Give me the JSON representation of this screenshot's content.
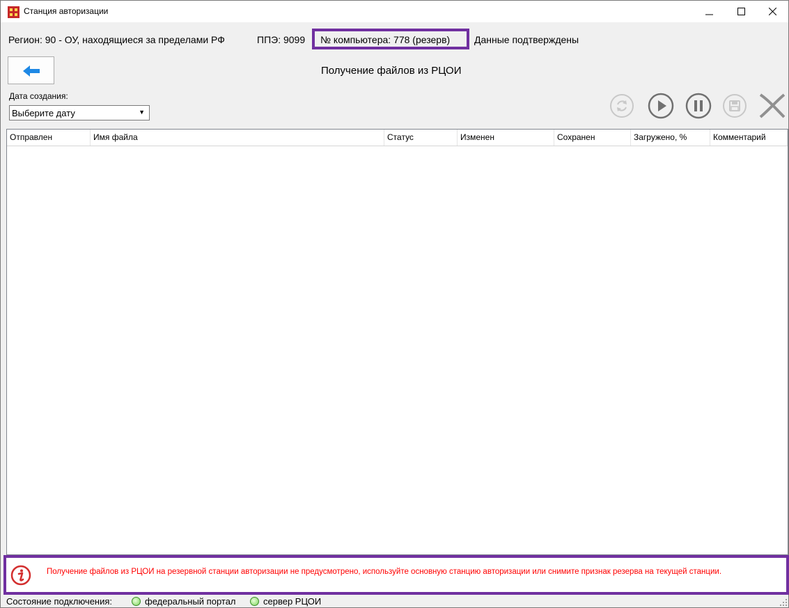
{
  "window": {
    "title": "Станция авторизации",
    "icon": "app-logo-icon"
  },
  "info": {
    "region": "Регион: 90 - ОУ, находящиеся за пределами РФ",
    "ppe": "ППЭ: 9099",
    "computer": "№ компьютера: 778 (резерв)",
    "status": "Данные подтверждены"
  },
  "page": {
    "title": "Получение файлов из РЦОИ"
  },
  "filter": {
    "label": "Дата создания:",
    "value": "Выберите дату"
  },
  "toolbar": [
    "refresh-icon",
    "play-icon",
    "pause-icon",
    "save-icon",
    "cancel-icon"
  ],
  "table": {
    "columns": [
      "Отправлен",
      "Имя файла",
      "Статус",
      "Изменен",
      "Сохранен",
      "Загружено, %",
      "Комментарий"
    ],
    "rows": []
  },
  "warning": {
    "text": "Получение файлов из РЦОИ на резервной станции авторизации не предусмотрено, используйте основную станцию авторизации или снимите признак резерва на текущей станции."
  },
  "statusbar": {
    "label": "Состояние подключения:",
    "items": [
      "федеральный портал",
      "сервер РЦОИ"
    ]
  },
  "colors": {
    "highlight": "#7030a0",
    "warning_text": "#ff0000",
    "back_arrow": "#1e88e5"
  }
}
